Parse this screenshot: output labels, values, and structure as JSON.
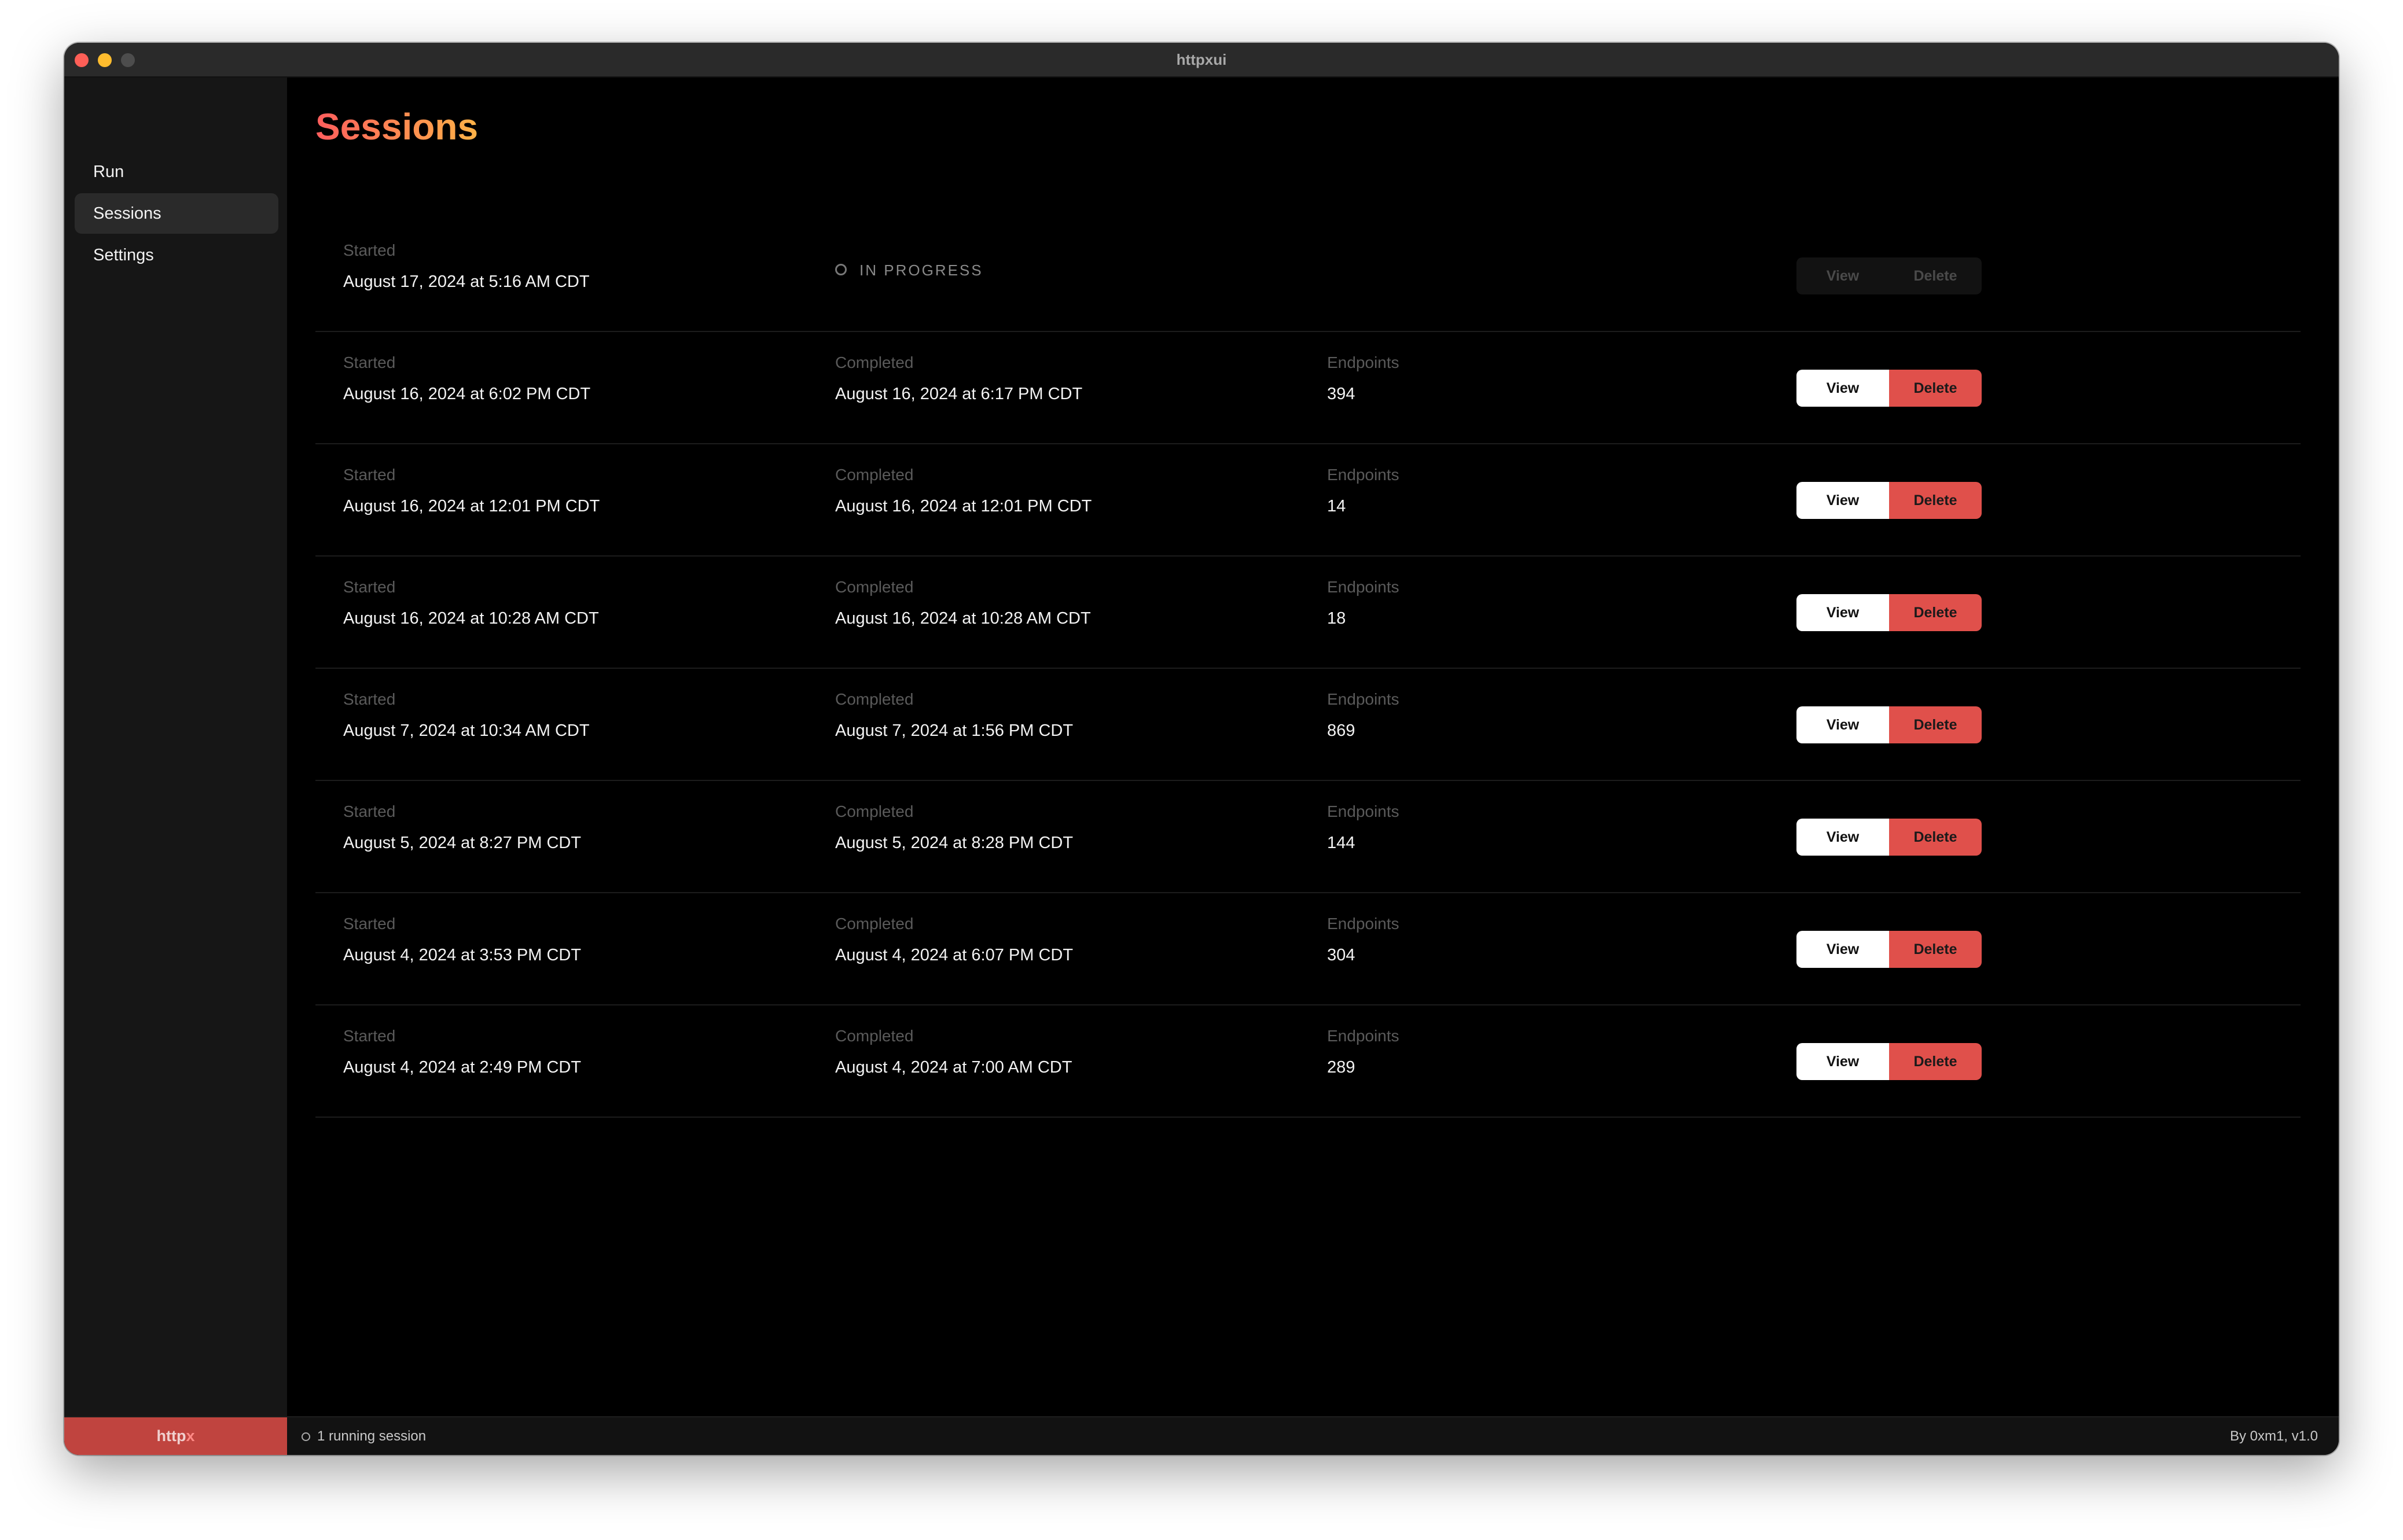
{
  "window": {
    "title": "httpxui"
  },
  "sidebar": {
    "items": [
      {
        "label": "Run"
      },
      {
        "label": "Sessions"
      },
      {
        "label": "Settings"
      }
    ]
  },
  "main": {
    "title": "Sessions",
    "labels": {
      "started": "Started",
      "completed": "Completed",
      "endpoints": "Endpoints"
    },
    "buttons": {
      "view": "View",
      "delete": "Delete"
    },
    "in_progress_label": "IN PROGRESS",
    "sessions": [
      {
        "started": "August 17, 2024 at 5:16 AM CDT",
        "status": "in-progress"
      },
      {
        "started": "August 16, 2024 at 6:02 PM CDT",
        "completed": "August 16, 2024 at 6:17 PM CDT",
        "endpoints": "394"
      },
      {
        "started": "August 16, 2024 at 12:01 PM CDT",
        "completed": "August 16, 2024 at 12:01 PM CDT",
        "endpoints": "14"
      },
      {
        "started": "August 16, 2024 at 10:28 AM CDT",
        "completed": "August 16, 2024 at 10:28 AM CDT",
        "endpoints": "18"
      },
      {
        "started": "August 7, 2024 at 10:34 AM CDT",
        "completed": "August 7, 2024 at 1:56 PM CDT",
        "endpoints": "869"
      },
      {
        "started": "August 5, 2024 at 8:27 PM CDT",
        "completed": "August 5, 2024 at 8:28 PM CDT",
        "endpoints": "144"
      },
      {
        "started": "August 4, 2024 at 3:53 PM CDT",
        "completed": "August 4, 2024 at 6:07 PM CDT",
        "endpoints": "304"
      },
      {
        "started": "August 4, 2024 at 2:49 PM CDT",
        "completed": "August 4, 2024 at 7:00 AM CDT",
        "endpoints": "289"
      }
    ]
  },
  "statusbar": {
    "brand": "http",
    "brand_x": "x",
    "running": "1 running session",
    "version": "By 0xm1, v1.0"
  },
  "colors": {
    "accent": "#e0504b",
    "brand_bg": "#c0443f",
    "title_gradient_start": "#ff5d5d",
    "title_gradient_end": "#ffb347"
  }
}
